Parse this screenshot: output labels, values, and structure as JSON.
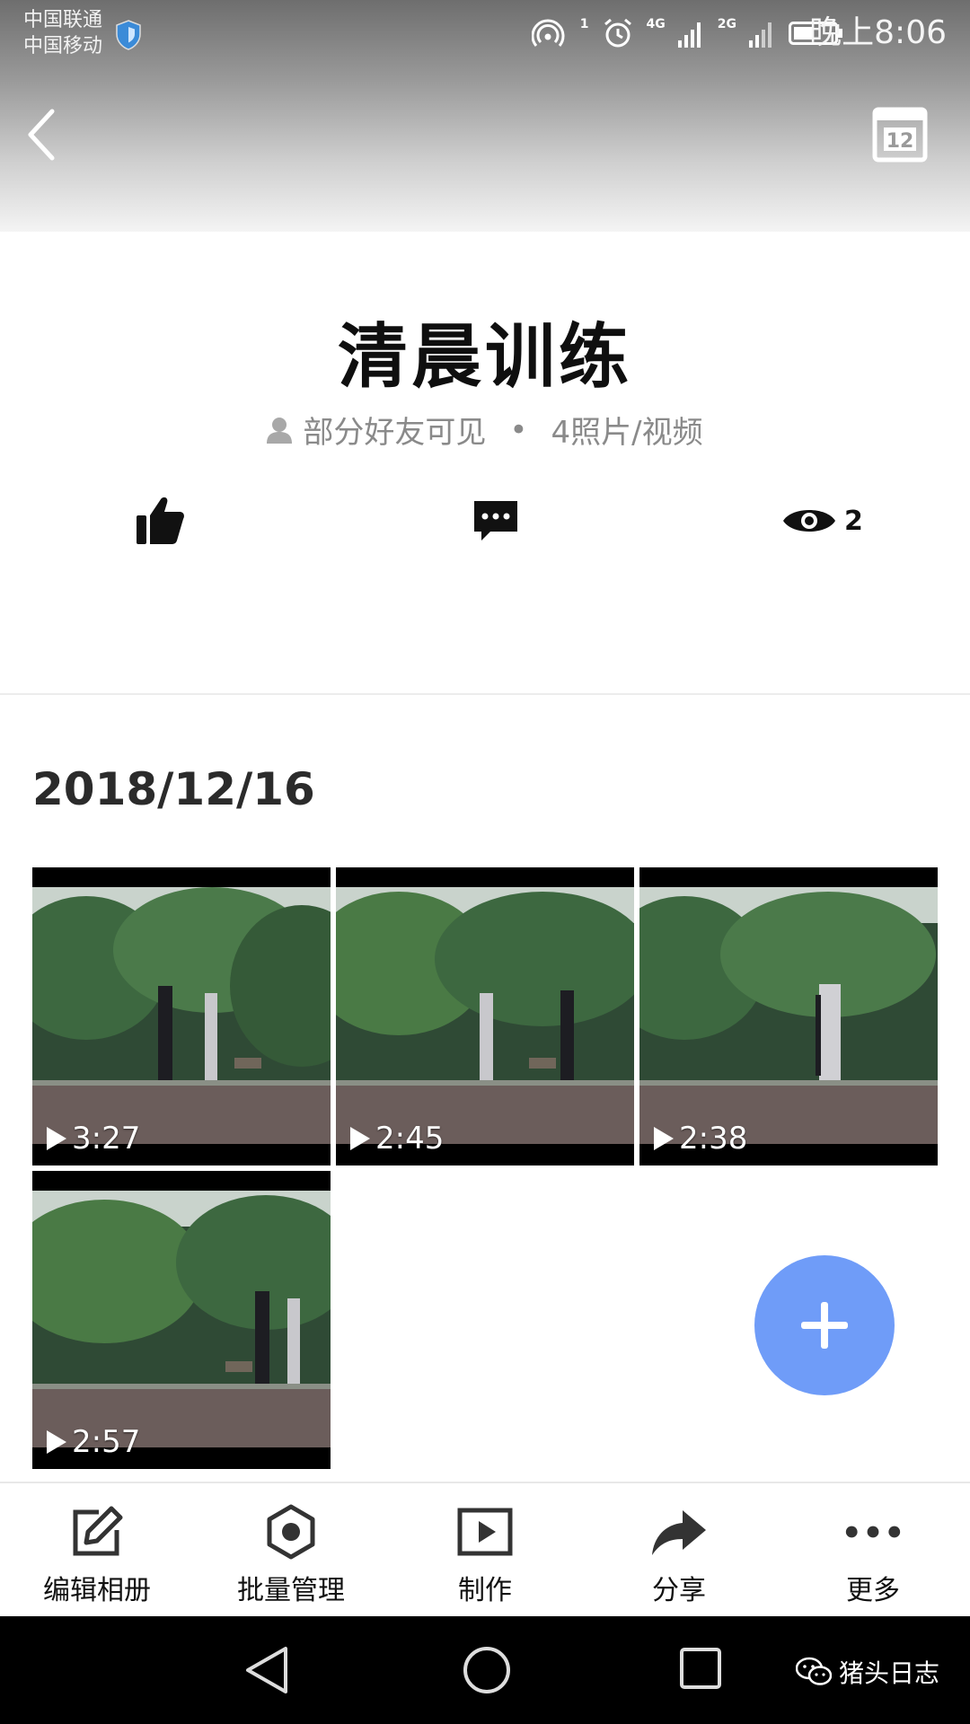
{
  "status_bar": {
    "carrier_1": "中国联通",
    "carrier_2": "中国移动",
    "net_1": "4G",
    "net_2": "2G",
    "hotspot_count": "1",
    "time": "晚上8:06"
  },
  "header": {
    "back_icon": "chevron-left-icon",
    "calendar_icon": "calendar-icon",
    "calendar_day": "12"
  },
  "album": {
    "title": "清晨训练",
    "visibility": "部分好友可见",
    "separator": "•",
    "count": "4照片/视频",
    "views": "2"
  },
  "section": {
    "date": "2018/12/16"
  },
  "videos": [
    {
      "duration": "3:27"
    },
    {
      "duration": "2:45"
    },
    {
      "duration": "2:38"
    },
    {
      "duration": "2:57"
    }
  ],
  "toolbar": {
    "edit_label": "编辑相册",
    "batch_label": "批量管理",
    "make_label": "制作",
    "share_label": "分享",
    "more_label": "更多"
  },
  "watermark": {
    "text": "猪头日志"
  },
  "colors": {
    "fab": "#6f9cf8",
    "text_primary": "#111111",
    "text_secondary": "#8a8a8a"
  }
}
